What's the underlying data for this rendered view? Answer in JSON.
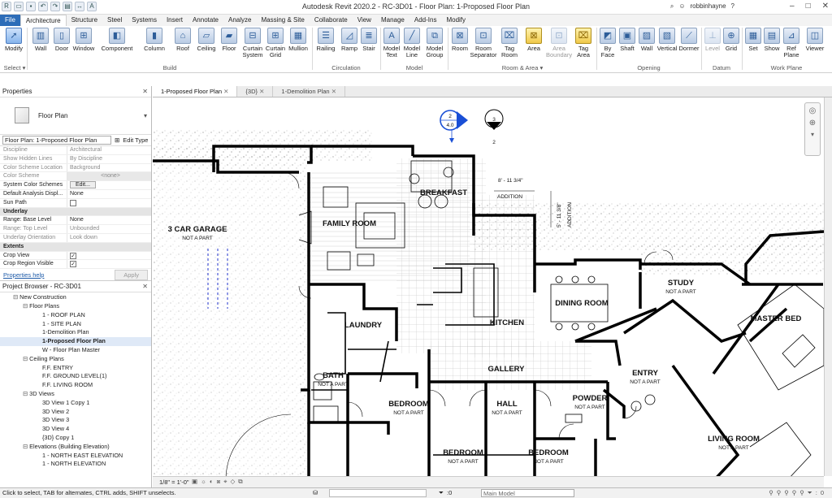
{
  "window": {
    "title": "Autodesk Revit 2020.2 - RC-3D01 - Floor Plan: 1-Proposed Floor Plan",
    "user": "robbinhayne"
  },
  "ribbon_tabs": [
    "File",
    "Architecture",
    "Structure",
    "Steel",
    "Systems",
    "Insert",
    "Annotate",
    "Analyze",
    "Massing & Site",
    "Collaborate",
    "View",
    "Manage",
    "Add-Ins",
    "Modify"
  ],
  "tools": {
    "modify": "Modify",
    "wall": "Wall",
    "door": "Door",
    "window": "Window",
    "component": "Component",
    "column": "Column",
    "roof": "Roof",
    "ceiling": "Ceiling",
    "floor": "Floor",
    "curtain_system": "Curtain System",
    "curtain_grid": "Curtain Grid",
    "mullion": "Mullion",
    "railing": "Railing",
    "ramp": "Ramp",
    "stair": "Stair",
    "model_text": "Model Text",
    "model_line": "Model Line",
    "model_group": "Model Group",
    "room": "Room",
    "room_separator": "Room Separator",
    "tag_room": "Tag Room",
    "area": "Area",
    "area_boundary": "Area Boundary",
    "tag_area": "Tag Area",
    "by_face": "By Face",
    "shaft": "Shaft",
    "wall_op": "Wall",
    "vertical": "Vertical",
    "dormer": "Dormer",
    "level": "Level",
    "grid": "Grid",
    "set": "Set",
    "show": "Show",
    "ref_plane": "Ref Plane",
    "viewer": "Viewer"
  },
  "panels": {
    "select": "Select ▾",
    "build": "Build",
    "circulation": "Circulation",
    "model": "Model",
    "room_area": "Room & Area ▾",
    "opening": "Opening",
    "datum": "Datum",
    "work_plane": "Work Plane"
  },
  "properties": {
    "header": "Properties",
    "type_name": "Floor Plan",
    "instance_selector": "Floor Plan: 1-Proposed Floor Plan",
    "edit_type": "Edit Type",
    "help": "Properties help",
    "apply": "Apply",
    "rows": [
      {
        "k": "Discipline",
        "v": "Architectural",
        "dim": true
      },
      {
        "k": "Show Hidden Lines",
        "v": "By Discipline",
        "dim": true
      },
      {
        "k": "Color Scheme Location",
        "v": "Background",
        "dim": true
      },
      {
        "k": "Color Scheme",
        "v": "<none>",
        "dim": true
      },
      {
        "k": "System Color Schemes",
        "v": "Edit..."
      },
      {
        "k": "Default Analysis Displ...",
        "v": "None"
      },
      {
        "k": "Sun Path",
        "v": ""
      }
    ],
    "underlay_header": "Underlay",
    "underlay_rows": [
      {
        "k": "Range: Base Level",
        "v": "None"
      },
      {
        "k": "Range: Top Level",
        "v": "Unbounded",
        "dim": true
      },
      {
        "k": "Underlay Orientation",
        "v": "Look down",
        "dim": true
      }
    ],
    "extents_header": "Extents",
    "extents_rows": [
      {
        "k": "Crop View",
        "v": ""
      },
      {
        "k": "Crop Region Visible",
        "v": ""
      }
    ]
  },
  "project_browser": {
    "header": "Project Browser - RC-3D01",
    "new_construction": "New Construction",
    "floor_plans_label": "Floor Plans",
    "floor_plans": [
      "1 - ROOF PLAN",
      "1 - SITE PLAN",
      "1-Demolition Plan",
      "1-Proposed Floor Plan",
      "W - Floor Plan Master"
    ],
    "ceiling_plans_label": "Ceiling Plans",
    "ceiling_plans": [
      "F.F. ENTRY",
      "F.F. GROUND LEVEL(1)",
      "F.F. LIVING ROOM"
    ],
    "views_3d_label": "3D Views",
    "views_3d": [
      "3D View 1 Copy 1",
      "3D View 2",
      "3D View 3",
      "3D View 4",
      "{3D} Copy 1"
    ],
    "elevations_label": "Elevations (Building Elevation)",
    "elevations": [
      "1 - NORTH EAST ELEVATION",
      "1 - NORTH ELEVATION"
    ]
  },
  "view_tabs": [
    "1-Proposed Floor Plan",
    "{3D}",
    "1-Demolition Plan"
  ],
  "plan": {
    "rooms": {
      "garage": "3 CAR GARAGE",
      "family": "FAMILY ROOM",
      "breakfast": "BREAKFAST",
      "laundry": "LAUNDRY",
      "kitchen": "KITCHEN",
      "dining": "DINING ROOM",
      "study": "STUDY",
      "master": "MASTER BED",
      "entry": "ENTRY",
      "gallery": "GALLERY",
      "bath": "BATH",
      "bedroom1": "BEDROOM",
      "hall": "HALL",
      "powder": "POWDER",
      "bedroom2": "BEDROOM",
      "bedroom3": "BEDROOM",
      "living": "LIVING ROOM"
    },
    "not_a_part": "NOT A PART",
    "section_top": "2",
    "section_bottom": "4.0",
    "elev_top": "3",
    "elev_bottom": "2",
    "dim_text": "8' - 11 3/4\"",
    "addition": "ADDITION",
    "addition_dim": "5' - 11 3/8\""
  },
  "status": {
    "message": "Click to select, TAB for alternates, CTRL adds, SHIFT unselects.",
    "scale": "1/8\" = 1'-0\"",
    "model": "Main Model",
    "zero": ":0"
  }
}
